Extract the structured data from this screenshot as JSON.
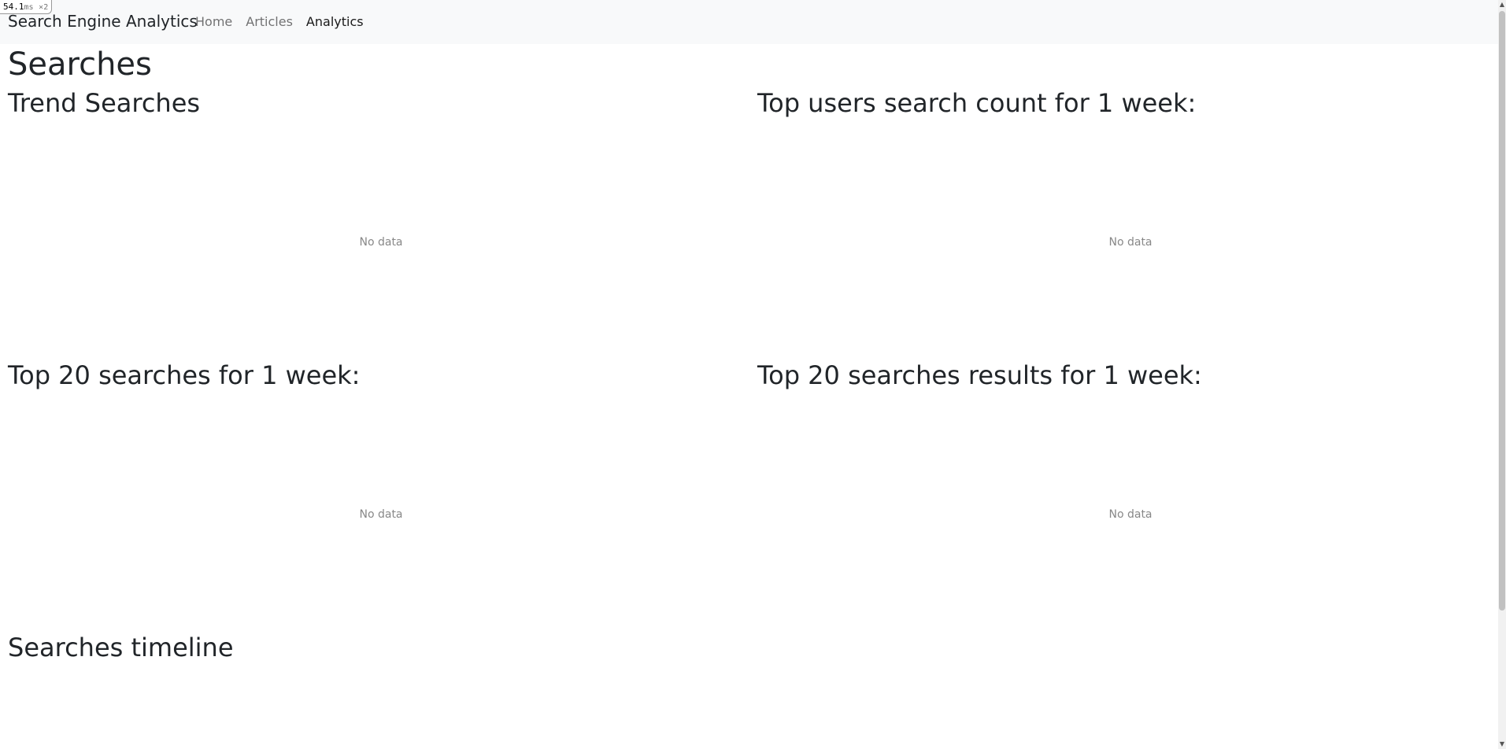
{
  "perf": {
    "value": "54.1",
    "unit": "ms",
    "multiplier": "×2"
  },
  "navbar": {
    "brand": "Search Engine Analytics",
    "links": [
      {
        "label": "Home",
        "active": false
      },
      {
        "label": "Articles",
        "active": false
      },
      {
        "label": "Analytics",
        "active": true
      }
    ]
  },
  "page": {
    "title": "Searches"
  },
  "panels": [
    {
      "title": "Trend Searches",
      "empty_text": "No data"
    },
    {
      "title": "Top users search count for 1 week:",
      "empty_text": "No data"
    },
    {
      "title": "Top 20 searches for 1 week:",
      "empty_text": "No data"
    },
    {
      "title": "Top 20 searches results for 1 week:",
      "empty_text": "No data"
    },
    {
      "title": "Searches timeline",
      "empty_text": ""
    }
  ],
  "colors": {
    "navbar_bg": "#f8f9fa",
    "text": "#212529",
    "muted": "#888888"
  }
}
